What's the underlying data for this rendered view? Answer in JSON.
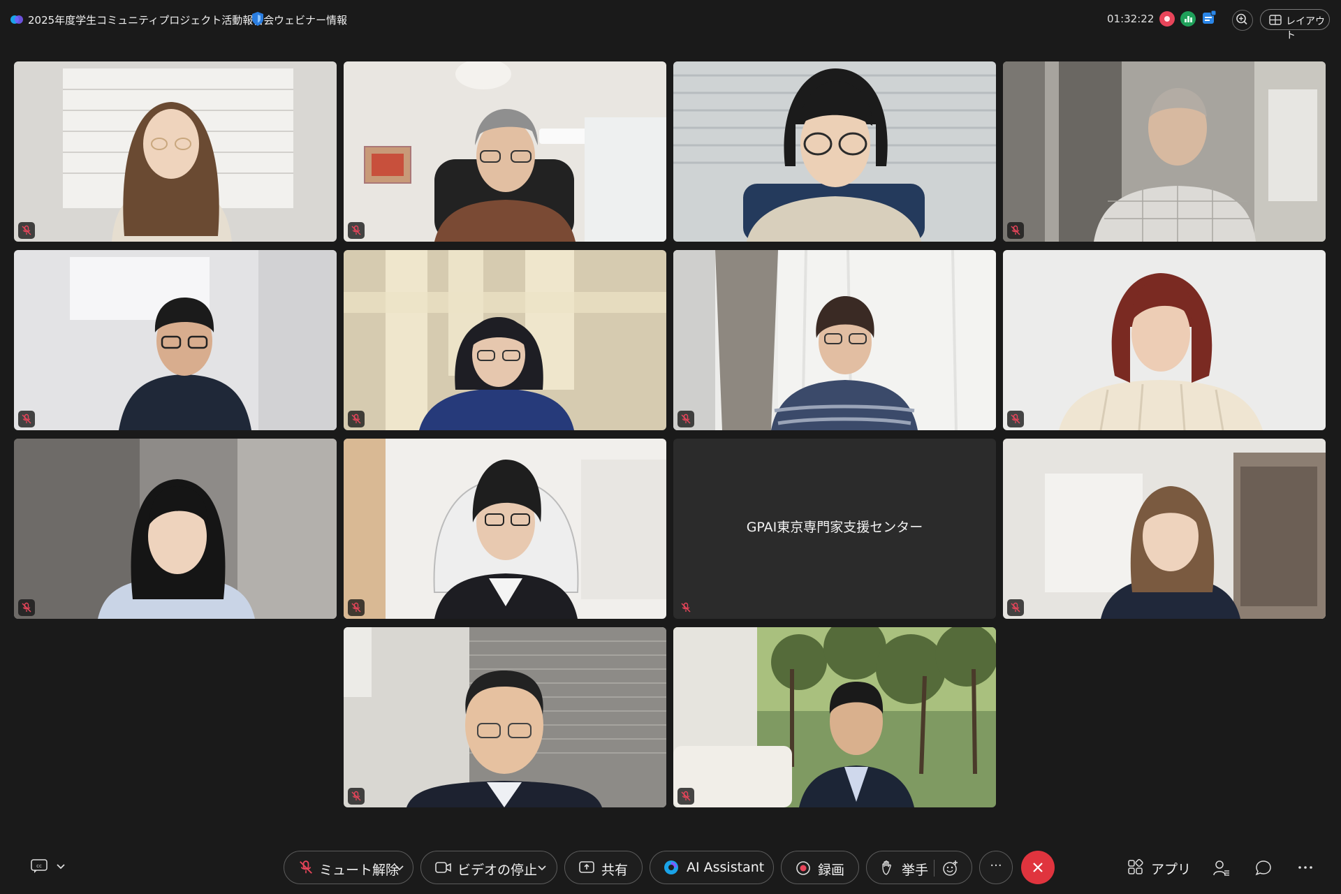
{
  "header": {
    "meeting_title": "2025年度学生コミュニティプロジェクト活動報告会",
    "webinar_info": "ウェビナー情報",
    "elapsed_time": "01:32:22",
    "layout_label": "レイアウト"
  },
  "tiles": [
    {
      "name": "",
      "muted": true
    },
    {
      "name": "",
      "muted": true
    },
    {
      "name": "",
      "muted": false
    },
    {
      "name": "",
      "muted": true
    },
    {
      "name": "",
      "muted": true
    },
    {
      "name": "",
      "muted": true
    },
    {
      "name": "",
      "muted": true
    },
    {
      "name": "",
      "muted": true
    },
    {
      "name": "",
      "muted": true
    },
    {
      "name": "",
      "muted": true
    },
    {
      "name": "GPAI東京専門家支援センター",
      "muted": true
    },
    {
      "name": "",
      "muted": true
    },
    {
      "name": "",
      "muted": true
    },
    {
      "name": "",
      "muted": true
    }
  ],
  "controls": {
    "unmute_label": "ミュート解除",
    "stop_video_label": "ビデオの停止",
    "share_label": "共有",
    "ai_assistant_label": "AI Assistant",
    "record_label": "録画",
    "raise_hand_label": "挙手",
    "apps_label": "アプリ",
    "more_label": "···"
  },
  "colors": {
    "background": "#1a1a1a",
    "end_call": "#e0343e",
    "recording": "#e8455a",
    "muted_mic": "#e8455a"
  }
}
